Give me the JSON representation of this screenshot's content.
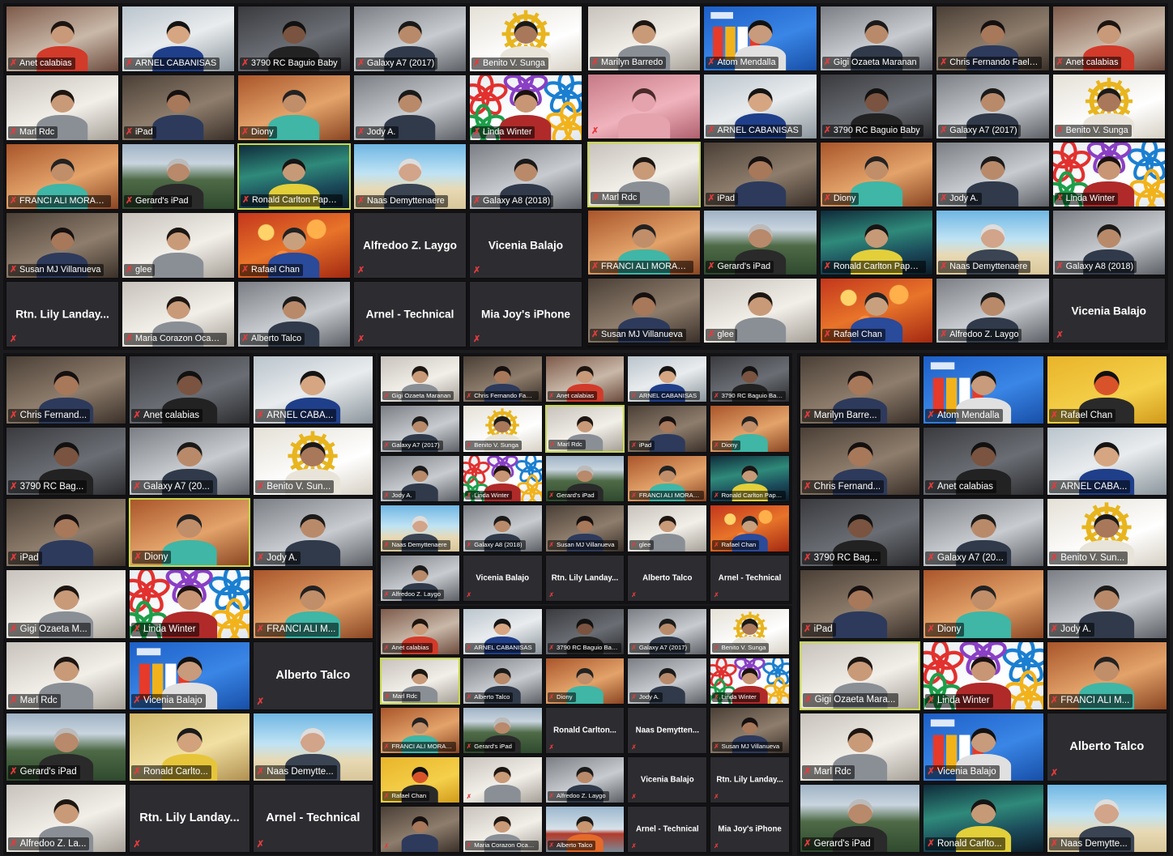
{
  "colors": {
    "muted_mic": "#e23b3b",
    "active_speaker_border": "#c9d84a",
    "tile_background": "#2c2c31"
  },
  "icons": {
    "muted": "microphone-muted-icon"
  },
  "panels": [
    {
      "id": "panel-a",
      "cols": 5,
      "rows": 5,
      "tiles": [
        {
          "label": "Anet calabias",
          "scene": "room-red"
        },
        {
          "label": "ARNEL CABANISAS",
          "scene": "office-blue"
        },
        {
          "label": "3790 RC Baguio Baby",
          "scene": "room-dark"
        },
        {
          "label": "Galaxy A7 (2017)",
          "scene": "room-gray"
        },
        {
          "label": "Benito V. Sunga",
          "scene": "emblem-gold"
        },
        {
          "label": "Marl Rdc",
          "scene": "room-white"
        },
        {
          "label": "iPad",
          "scene": "room-dim"
        },
        {
          "label": "Diony",
          "scene": "room-orange"
        },
        {
          "label": "Jody A.",
          "scene": "room-gray"
        },
        {
          "label": "Linda Winter",
          "scene": "flowers"
        },
        {
          "label": "FRANCI ALI MORALES",
          "scene": "room-orange"
        },
        {
          "label": "Gerard's iPad",
          "scene": "mountain"
        },
        {
          "label": "Ronald Carlton Papa Tan",
          "scene": "aurora",
          "active": true
        },
        {
          "label": "Naas Demyttenaere",
          "scene": "beach"
        },
        {
          "label": "Galaxy A8 (2018)",
          "scene": "room-gray"
        },
        {
          "label": "Susan MJ Villanueva",
          "scene": "room-dim"
        },
        {
          "label": "glee",
          "scene": "room-white"
        },
        {
          "label": "Rafael Chan",
          "scene": "bokeh"
        },
        {
          "bigname": "Alfredoo Z. Laygo"
        },
        {
          "bigname": "Vicenia Balajo"
        },
        {
          "bigname": "Rtn. Lily Landay..."
        },
        {
          "label": "Maria Corazon Ocam...",
          "scene": "room-white"
        },
        {
          "label": "Alberto Talco",
          "scene": "room-gray"
        },
        {
          "bigname": "Arnel - Technical"
        },
        {
          "bigname": "Mia Joy's iPhone"
        }
      ]
    },
    {
      "id": "panel-b",
      "cols": 5,
      "rows": 5,
      "tiles": [
        {
          "label": "Marilyn Barredo",
          "scene": "room-white"
        },
        {
          "label": "Atom Mendalla",
          "scene": "rotary"
        },
        {
          "label": "Gigi Ozaeta Maranan",
          "scene": "room-gray"
        },
        {
          "label": "Chris Fernando Faelnar",
          "scene": "room-dim"
        },
        {
          "label": "Anet calabias",
          "scene": "room-red"
        },
        {
          "label": "",
          "scene": "closeup-pink"
        },
        {
          "label": "ARNEL CABANISAS",
          "scene": "office-blue"
        },
        {
          "label": "3790 RC Baguio Baby",
          "scene": "room-dark"
        },
        {
          "label": "Galaxy A7 (2017)",
          "scene": "room-gray"
        },
        {
          "label": "Benito V. Sunga",
          "scene": "emblem-gold"
        },
        {
          "label": "Marl Rdc",
          "scene": "room-white",
          "active": true
        },
        {
          "label": "iPad",
          "scene": "room-dim"
        },
        {
          "label": "Diony",
          "scene": "room-orange"
        },
        {
          "label": "Jody A.",
          "scene": "room-gray"
        },
        {
          "label": "Linda Winter",
          "scene": "flowers"
        },
        {
          "label": "FRANCI ALI MORALES",
          "scene": "room-orange"
        },
        {
          "label": "Gerard's iPad",
          "scene": "mountain"
        },
        {
          "label": "Ronald Carlton Papa Tan",
          "scene": "aurora"
        },
        {
          "label": "Naas Demyttenaere",
          "scene": "beach"
        },
        {
          "label": "Galaxy A8 (2018)",
          "scene": "room-gray"
        },
        {
          "label": "Susan MJ Villanueva",
          "scene": "room-dim"
        },
        {
          "label": "glee",
          "scene": "room-white"
        },
        {
          "label": "Rafael Chan",
          "scene": "bokeh"
        },
        {
          "label": "Alfredoo Z. Laygo",
          "scene": "room-gray"
        },
        {
          "bigname": "Vicenia Balajo"
        },
        {
          "bigname": "Rtn. Lily Landay..."
        }
      ]
    },
    {
      "id": "panel-c",
      "cols": 3,
      "rows": 7,
      "tiles": [
        {
          "label": "Chris Fernand...",
          "scene": "room-dim"
        },
        {
          "label": "Anet calabias",
          "scene": "room-dark"
        },
        {
          "label": "ARNEL CABA...",
          "scene": "office-blue"
        },
        {
          "label": "3790 RC Bag...",
          "scene": "room-dark"
        },
        {
          "label": "Galaxy A7 (20...",
          "scene": "room-gray"
        },
        {
          "label": "Benito V. Sun...",
          "scene": "emblem-gold"
        },
        {
          "label": "iPad",
          "scene": "room-dim"
        },
        {
          "label": "Diony",
          "scene": "room-orange",
          "active": true
        },
        {
          "label": "Jody A.",
          "scene": "room-gray"
        },
        {
          "label": "Gigi Ozaeta M...",
          "scene": "room-white"
        },
        {
          "label": "Linda Winter",
          "scene": "flowers"
        },
        {
          "label": "FRANCI ALI M...",
          "scene": "room-orange"
        },
        {
          "label": "Marl Rdc",
          "scene": "room-white"
        },
        {
          "label": "Vicenia Balajo",
          "scene": "rotary"
        },
        {
          "bigname": "Alberto Talco"
        },
        {
          "label": "Gerard's iPad",
          "scene": "mountain"
        },
        {
          "label": "Ronald Carlto...",
          "scene": "room-yellow"
        },
        {
          "label": "Naas Demytte...",
          "scene": "beach"
        },
        {
          "label": "Alfredoo Z. La...",
          "scene": "room-white"
        },
        {
          "bigname": "Rtn. Lily Landay..."
        },
        {
          "bigname": "Arnel - Technical"
        }
      ]
    },
    {
      "id": "panel-d",
      "cols": 5,
      "rows": 5,
      "tiles": [
        {
          "label": "Gigi Ozaeta Maranan",
          "scene": "room-white"
        },
        {
          "label": "Chris Fernando Faelnar",
          "scene": "room-dim"
        },
        {
          "label": "Anet calabias",
          "scene": "room-red"
        },
        {
          "label": "ARNEL CABANISAS",
          "scene": "office-blue"
        },
        {
          "label": "3790 RC Baguio Baby",
          "scene": "room-dark"
        },
        {
          "label": "Galaxy A7 (2017)",
          "scene": "room-gray"
        },
        {
          "label": "Benito V. Sunga",
          "scene": "emblem-gold"
        },
        {
          "label": "Marl Rdc",
          "scene": "room-white",
          "active": true
        },
        {
          "label": "iPad",
          "scene": "room-dim"
        },
        {
          "label": "Diony",
          "scene": "room-orange"
        },
        {
          "label": "Jody A.",
          "scene": "room-gray"
        },
        {
          "label": "Linda Winter",
          "scene": "flowers"
        },
        {
          "label": "Gerard's iPad",
          "scene": "mountain"
        },
        {
          "label": "FRANCI ALI MORALES",
          "scene": "room-orange"
        },
        {
          "label": "Ronald Carlton Papa Tan",
          "scene": "aurora"
        },
        {
          "label": "Naas Demyttenaere",
          "scene": "beach"
        },
        {
          "label": "Galaxy A8 (2018)",
          "scene": "room-gray"
        },
        {
          "label": "Susan MJ Villanueva",
          "scene": "room-dim"
        },
        {
          "label": "glee",
          "scene": "room-white"
        },
        {
          "label": "Rafael Chan",
          "scene": "bokeh"
        },
        {
          "label": "Alfredoo Z. Laygo",
          "scene": "room-gray"
        },
        {
          "bigname": "Vicenia Balajo"
        },
        {
          "bigname": "Rtn. Lily Landay..."
        },
        {
          "bigname": "Alberto Talco"
        },
        {
          "bigname": "Arnel - Technical"
        }
      ]
    },
    {
      "id": "panel-e",
      "cols": 5,
      "rows": 5,
      "tiles": [
        {
          "label": "Anet calabias",
          "scene": "room-red"
        },
        {
          "label": "ARNEL CABANISAS",
          "scene": "office-blue"
        },
        {
          "label": "3790 RC Baguio Baby",
          "scene": "room-dark"
        },
        {
          "label": "Galaxy A7 (2017)",
          "scene": "room-gray"
        },
        {
          "label": "Benito V. Sunga",
          "scene": "emblem-gold"
        },
        {
          "label": "Marl Rdc",
          "scene": "room-white",
          "active": true
        },
        {
          "label": "Alberto Talco",
          "scene": "room-gray"
        },
        {
          "label": "Diony",
          "scene": "room-orange"
        },
        {
          "label": "Jody A.",
          "scene": "room-gray"
        },
        {
          "label": "Linda Winter",
          "scene": "flowers"
        },
        {
          "label": "FRANCI ALI MORALES",
          "scene": "room-orange"
        },
        {
          "label": "Gerard's iPad",
          "scene": "mountain"
        },
        {
          "bigname": "Ronald Carlton..."
        },
        {
          "bigname": "Naas Demytten..."
        },
        {
          "label": "Susan MJ Villanueva",
          "scene": "room-dim"
        },
        {
          "label": "Rafael Chan",
          "scene": "portrait-art"
        },
        {
          "label": "",
          "scene": "room-white"
        },
        {
          "label": "Alfredoo Z. Laygo",
          "scene": "room-gray"
        },
        {
          "bigname": "Vicenia Balajo"
        },
        {
          "bigname": "Rtn. Lily Landay..."
        },
        {
          "label": "",
          "scene": "room-dim"
        },
        {
          "label": "Maria Corazon Ocam...",
          "scene": "room-white"
        },
        {
          "label": "Alberto Talco",
          "scene": "bridge"
        },
        {
          "bigname": "Arnel - Technical"
        },
        {
          "bigname": "Mia Joy's iPhone"
        }
      ]
    },
    {
      "id": "panel-f",
      "cols": 3,
      "rows": 7,
      "tiles": [
        {
          "label": "Marilyn Barre...",
          "scene": "room-dim"
        },
        {
          "label": "Atom Mendalla",
          "scene": "rotary"
        },
        {
          "label": "Rafael Chan",
          "scene": "portrait-art"
        },
        {
          "label": "Chris Fernand...",
          "scene": "room-dim"
        },
        {
          "label": "Anet calabias",
          "scene": "room-dark"
        },
        {
          "label": "ARNEL CABA...",
          "scene": "office-blue"
        },
        {
          "label": "3790 RC Bag...",
          "scene": "room-dark"
        },
        {
          "label": "Galaxy A7 (20...",
          "scene": "room-gray"
        },
        {
          "label": "Benito V. Sun...",
          "scene": "emblem-gold"
        },
        {
          "label": "iPad",
          "scene": "room-dim"
        },
        {
          "label": "Diony",
          "scene": "room-orange"
        },
        {
          "label": "Jody A.",
          "scene": "room-gray"
        },
        {
          "label": "Gigi Ozaeta Mara...",
          "scene": "room-white",
          "active": true
        },
        {
          "label": "Linda Winter",
          "scene": "flowers"
        },
        {
          "label": "FRANCI ALI M...",
          "scene": "room-orange"
        },
        {
          "label": "Marl Rdc",
          "scene": "room-white"
        },
        {
          "label": "Vicenia Balajo",
          "scene": "rotary"
        },
        {
          "bigname": "Alberto Talco"
        },
        {
          "label": "Gerard's iPad",
          "scene": "mountain"
        },
        {
          "label": "Ronald Carlto...",
          "scene": "aurora"
        },
        {
          "label": "Naas Demytte...",
          "scene": "beach"
        }
      ]
    }
  ]
}
